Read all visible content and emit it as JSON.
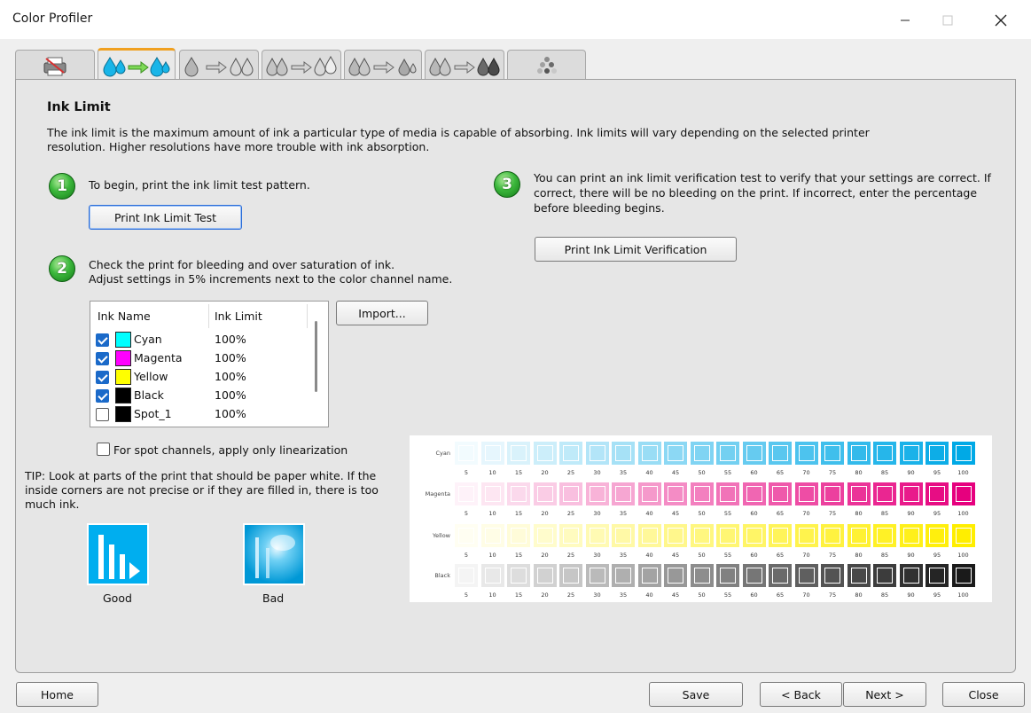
{
  "window": {
    "title": "Color Profiler"
  },
  "tabs": [
    {
      "icon": "printer-media-icon",
      "active": false
    },
    {
      "icon": "ink-limit-icon",
      "active": true
    },
    {
      "icon": "linearization-icon",
      "active": false
    },
    {
      "icon": "icc-profile-icon",
      "active": false
    },
    {
      "icon": "gray-balance-icon",
      "active": false
    },
    {
      "icon": "black-ink-icon",
      "active": false
    },
    {
      "icon": "save-profile-icon",
      "active": false
    }
  ],
  "section": {
    "title": "Ink Limit",
    "description_1": "The ink limit is the maximum amount of ink a particular type of media is capable of absorbing. Ink limits will vary depending on the selected printer",
    "description_2": "resolution. Higher resolutions have more trouble with ink absorption."
  },
  "step1": {
    "number": "1",
    "text": "To begin, print the ink limit test pattern.",
    "button": "Print Ink Limit Test"
  },
  "step2": {
    "number": "2",
    "text_1": "Check the print for bleeding and over saturation of ink.",
    "text_2": "Adjust settings in 5% increments next to the color channel name.",
    "import_button": "Import..."
  },
  "step3": {
    "number": "3",
    "text_1": "You can print an ink limit verification test to verify that your settings are correct. If",
    "text_2": "correct, there will be no bleeding on the print. If incorrect, enter the percentage",
    "text_3": "before bleeding begins.",
    "button": "Print Ink Limit Verification"
  },
  "ink_table": {
    "col_name": "Ink Name",
    "col_limit": "Ink Limit",
    "rows": [
      {
        "name": "Cyan",
        "limit": "100%",
        "checked": true,
        "color": "#00ffff"
      },
      {
        "name": "Magenta",
        "limit": "100%",
        "checked": true,
        "color": "#ff00ff"
      },
      {
        "name": "Yellow",
        "limit": "100%",
        "checked": true,
        "color": "#ffff00"
      },
      {
        "name": "Black",
        "limit": "100%",
        "checked": true,
        "color": "#000000"
      },
      {
        "name": "Spot_1",
        "limit": "100%",
        "checked": false,
        "color": "#000000"
      }
    ]
  },
  "spot_option": {
    "label": "For spot channels, apply only linearization",
    "checked": false
  },
  "tip": {
    "line_1": "TIP: Look at parts of the print that should be paper white. If the",
    "line_2": "inside corners are not precise or if they are filled in, there is too",
    "line_3": "much ink."
  },
  "examples": {
    "good": "Good",
    "bad": "Bad"
  },
  "test_chart": {
    "rows": [
      {
        "label": "Cyan",
        "color": "#00a9e6"
      },
      {
        "label": "Magenta",
        "color": "#e6007e"
      },
      {
        "label": "Yellow",
        "color": "#ffee00"
      },
      {
        "label": "Black",
        "color": "#1a1a1a"
      }
    ],
    "steps": [
      "5",
      "10",
      "15",
      "20",
      "25",
      "30",
      "35",
      "40",
      "45",
      "50",
      "55",
      "60",
      "65",
      "70",
      "75",
      "80",
      "85",
      "90",
      "95",
      "100"
    ]
  },
  "footer": {
    "home": "Home",
    "save": "Save",
    "back": "< Back",
    "next": "Next >",
    "close": "Close"
  }
}
